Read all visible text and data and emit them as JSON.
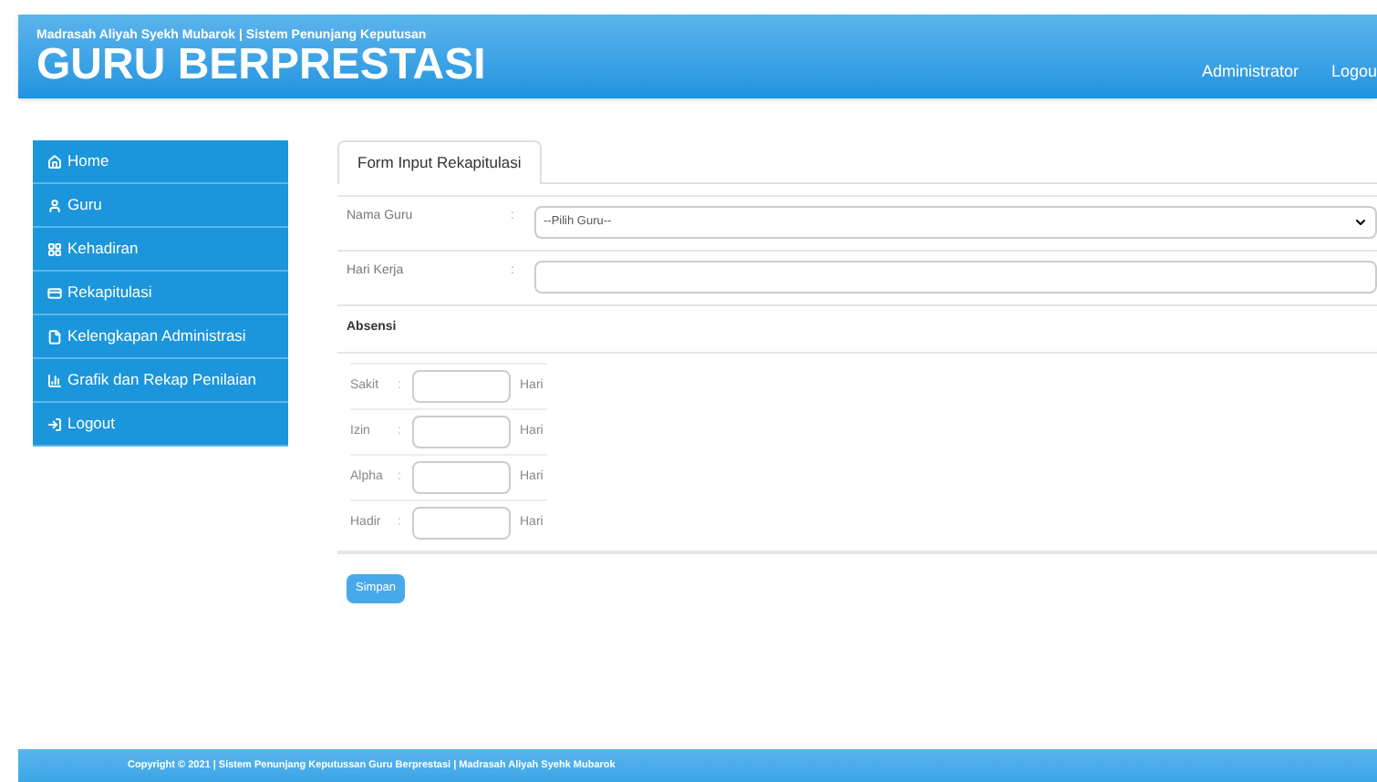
{
  "header": {
    "subtitle": "Madrasah Aliyah Syekh Mubarok | Sistem Penunjang Keputusan",
    "title": "GURU BERPRESTASI",
    "nav": [
      "Administrator",
      "Logou"
    ]
  },
  "sidebar": {
    "items": [
      {
        "label": "Home"
      },
      {
        "label": "Guru"
      },
      {
        "label": "Kehadiran"
      },
      {
        "label": "Rekapitulasi"
      },
      {
        "label": "Kelengkapan Administrasi"
      },
      {
        "label": "Grafik dan Rekap Penilaian"
      },
      {
        "label": "Logout"
      }
    ]
  },
  "tabs": [
    {
      "label": "Form Input Rekapitulasi",
      "selected": true
    }
  ],
  "form": {
    "fields": [
      {
        "label": "Nama Guru",
        "separator": ":",
        "kind": "select",
        "value": "--Pilih Guru--"
      },
      {
        "label": "Hari Kerja",
        "separator": ":",
        "kind": "text"
      }
    ],
    "section": "Absensi",
    "absensi": [
      {
        "label": "Sakit",
        "separator": ":",
        "unit": "Hari"
      },
      {
        "label": "Izin",
        "separator": ":",
        "unit": "Hari"
      },
      {
        "label": "Alpha",
        "separator": ":",
        "unit": "Hari"
      },
      {
        "label": "Hadir",
        "separator": ":",
        "unit": "Hari"
      }
    ],
    "submit": "Simpan"
  },
  "footer": "Copyright © 2021 | Sistem Penunjang Keputussan Guru Berprestasi | Madrasah Aliyah Syehk Mubarok"
}
